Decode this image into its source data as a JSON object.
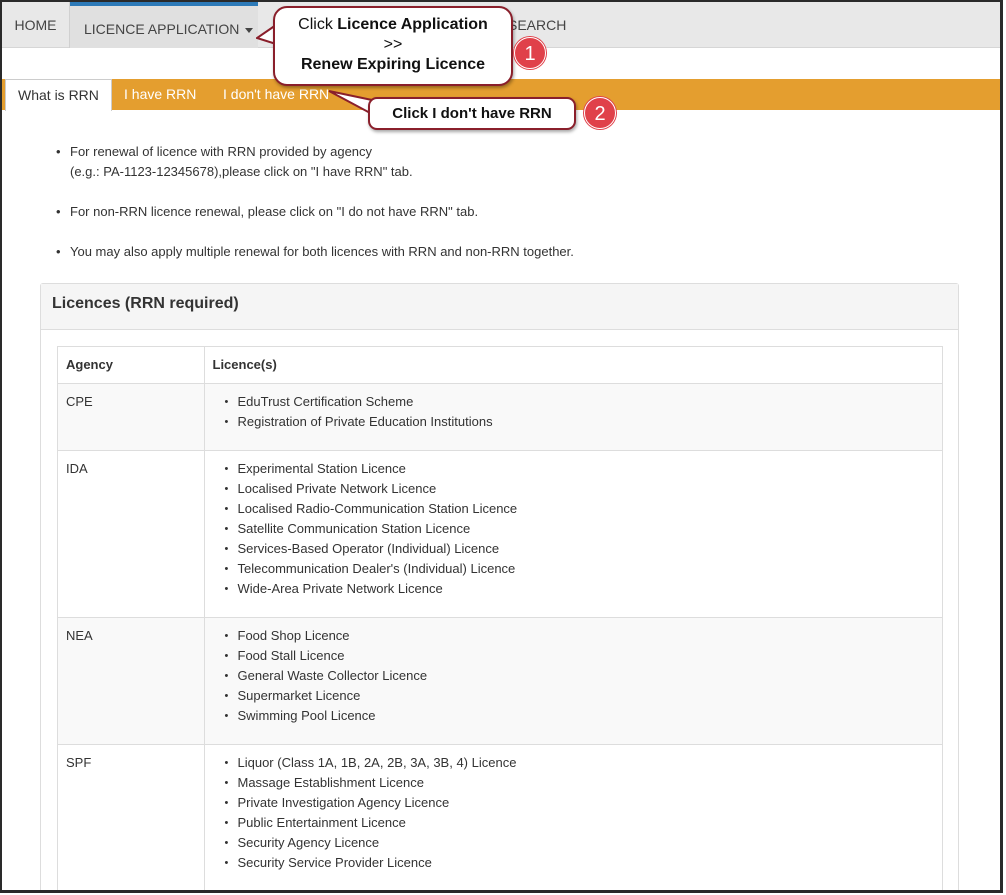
{
  "topnav": {
    "home": "HOME",
    "licence_application": "LICENCE APPLICATION",
    "search": "SEARCH"
  },
  "tabs": [
    {
      "label": "What is RRN"
    },
    {
      "label": "I have RRN"
    },
    {
      "label": "I don't have RRN"
    }
  ],
  "intro": {
    "p1_line1": "For renewal of licence with RRN provided by agency",
    "p1_line2": "(e.g.: PA-1123-12345678),please click on \"I have RRN\" tab.",
    "p2": "For non-RRN licence renewal, please click on \"I do not have RRN\" tab.",
    "p3": "You may also apply multiple renewal for both licences with RRN and non-RRN together."
  },
  "panel": {
    "title": "Licences (RRN required)",
    "headers": {
      "agency": "Agency",
      "licences": "Licence(s)"
    },
    "rows": [
      {
        "agency": "CPE",
        "licences": [
          "EduTrust Certification Scheme",
          "Registration of Private Education Institutions"
        ]
      },
      {
        "agency": "IDA",
        "licences": [
          "Experimental Station Licence",
          "Localised Private Network Licence",
          "Localised Radio-Communication Station Licence",
          "Satellite Communication Station Licence",
          "Services-Based Operator (Individual) Licence",
          "Telecommunication Dealer's (Individual) Licence",
          "Wide-Area Private Network Licence"
        ]
      },
      {
        "agency": "NEA",
        "licences": [
          "Food Shop Licence",
          "Food Stall Licence",
          "General Waste Collector Licence",
          "Supermarket Licence",
          "Swimming Pool Licence"
        ]
      },
      {
        "agency": "SPF",
        "licences": [
          "Liquor (Class 1A, 1B, 2A, 2B, 3A, 3B, 4) Licence",
          "Massage Establishment Licence",
          "Private Investigation Agency Licence",
          "Public Entertainment Licence",
          "Security Agency Licence",
          "Security Service Provider Licence"
        ]
      }
    ]
  },
  "callouts": {
    "c1_prefix": "Click ",
    "c1_bold": "Licence Application",
    "c1_arrow": ">>",
    "c1_line3": "Renew Expiring Licence",
    "c1_badge": "1",
    "c2_text": "Click I don't have RRN",
    "c2_badge": "2"
  },
  "colors": {
    "tab_bar": "#e49e2f",
    "nav_accent": "#2d7ab8",
    "callout_border": "#8a1f2b",
    "badge": "#e0414a"
  }
}
